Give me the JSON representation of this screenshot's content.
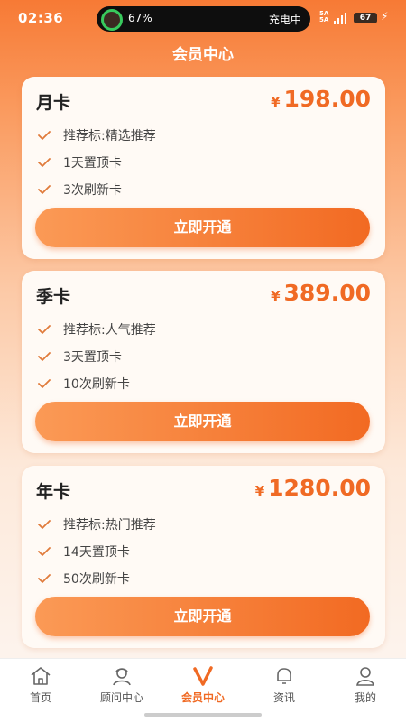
{
  "status_bar": {
    "time": "02:36",
    "battery_ring_percent": "67%",
    "charging_label": "充电中",
    "signal_text_1": "5A",
    "signal_text_2": "5A",
    "battery_level": "67"
  },
  "header": {
    "title": "会员中心"
  },
  "cards": [
    {
      "name": "月卡",
      "currency": "¥",
      "price": "198.00",
      "features": [
        "推荐标:精选推荐",
        "1天置顶卡",
        "3次刷新卡"
      ],
      "button_label": "立即开通"
    },
    {
      "name": "季卡",
      "currency": "¥",
      "price": "389.00",
      "features": [
        "推荐标:人气推荐",
        "3天置顶卡",
        "10次刷新卡"
      ],
      "button_label": "立即开通"
    },
    {
      "name": "年卡",
      "currency": "¥",
      "price": "1280.00",
      "features": [
        "推荐标:热门推荐",
        "14天置顶卡",
        "50次刷新卡"
      ],
      "button_label": "立即开通"
    }
  ],
  "bottom_nav": {
    "items": [
      {
        "label": "首页",
        "icon": "home-icon"
      },
      {
        "label": "顾问中心",
        "icon": "consultant-icon"
      },
      {
        "label": "会员中心",
        "icon": "v-icon",
        "active": true
      },
      {
        "label": "资讯",
        "icon": "bell-icon"
      },
      {
        "label": "我的",
        "icon": "user-icon"
      }
    ]
  },
  "colors": {
    "accent": "#f06a24",
    "check": "#e07a3a",
    "active_tab": "#f06a24"
  }
}
